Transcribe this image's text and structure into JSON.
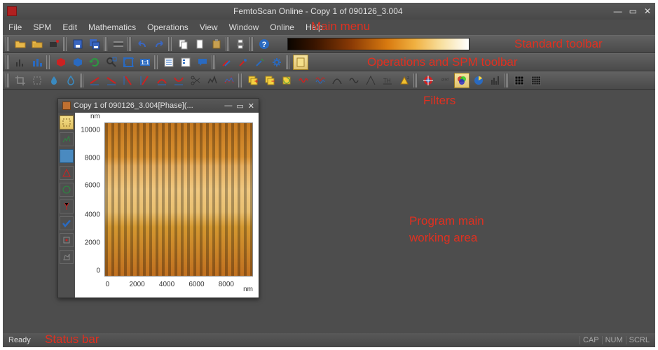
{
  "titlebar": {
    "app_name": "FemtoScan Online",
    "doc_name": "Copy 1 of 090126_3.004"
  },
  "menu": {
    "items": [
      "File",
      "SPM",
      "Edit",
      "Mathematics",
      "Operations",
      "View",
      "Window",
      "Online",
      "Help"
    ]
  },
  "child_window": {
    "title": "Copy 1 of 090126_3.004[Phase](...",
    "x_unit": "nm",
    "y_unit": "nm",
    "y_ticks": [
      0,
      2000,
      4000,
      6000,
      8000,
      10000
    ],
    "x_ticks": [
      0,
      2000,
      4000,
      6000,
      8000
    ]
  },
  "status": {
    "ready": "Ready",
    "indicators": [
      "CAP",
      "NUM",
      "SCRL"
    ]
  },
  "annotations": {
    "main_menu": "Main menu",
    "standard_toolbar": "Standard toolbar",
    "ops_toolbar": "Operations and SPM toolbar",
    "filters": "Filters",
    "main_area": "Program main\nworking area",
    "status_bar": "Status bar"
  }
}
